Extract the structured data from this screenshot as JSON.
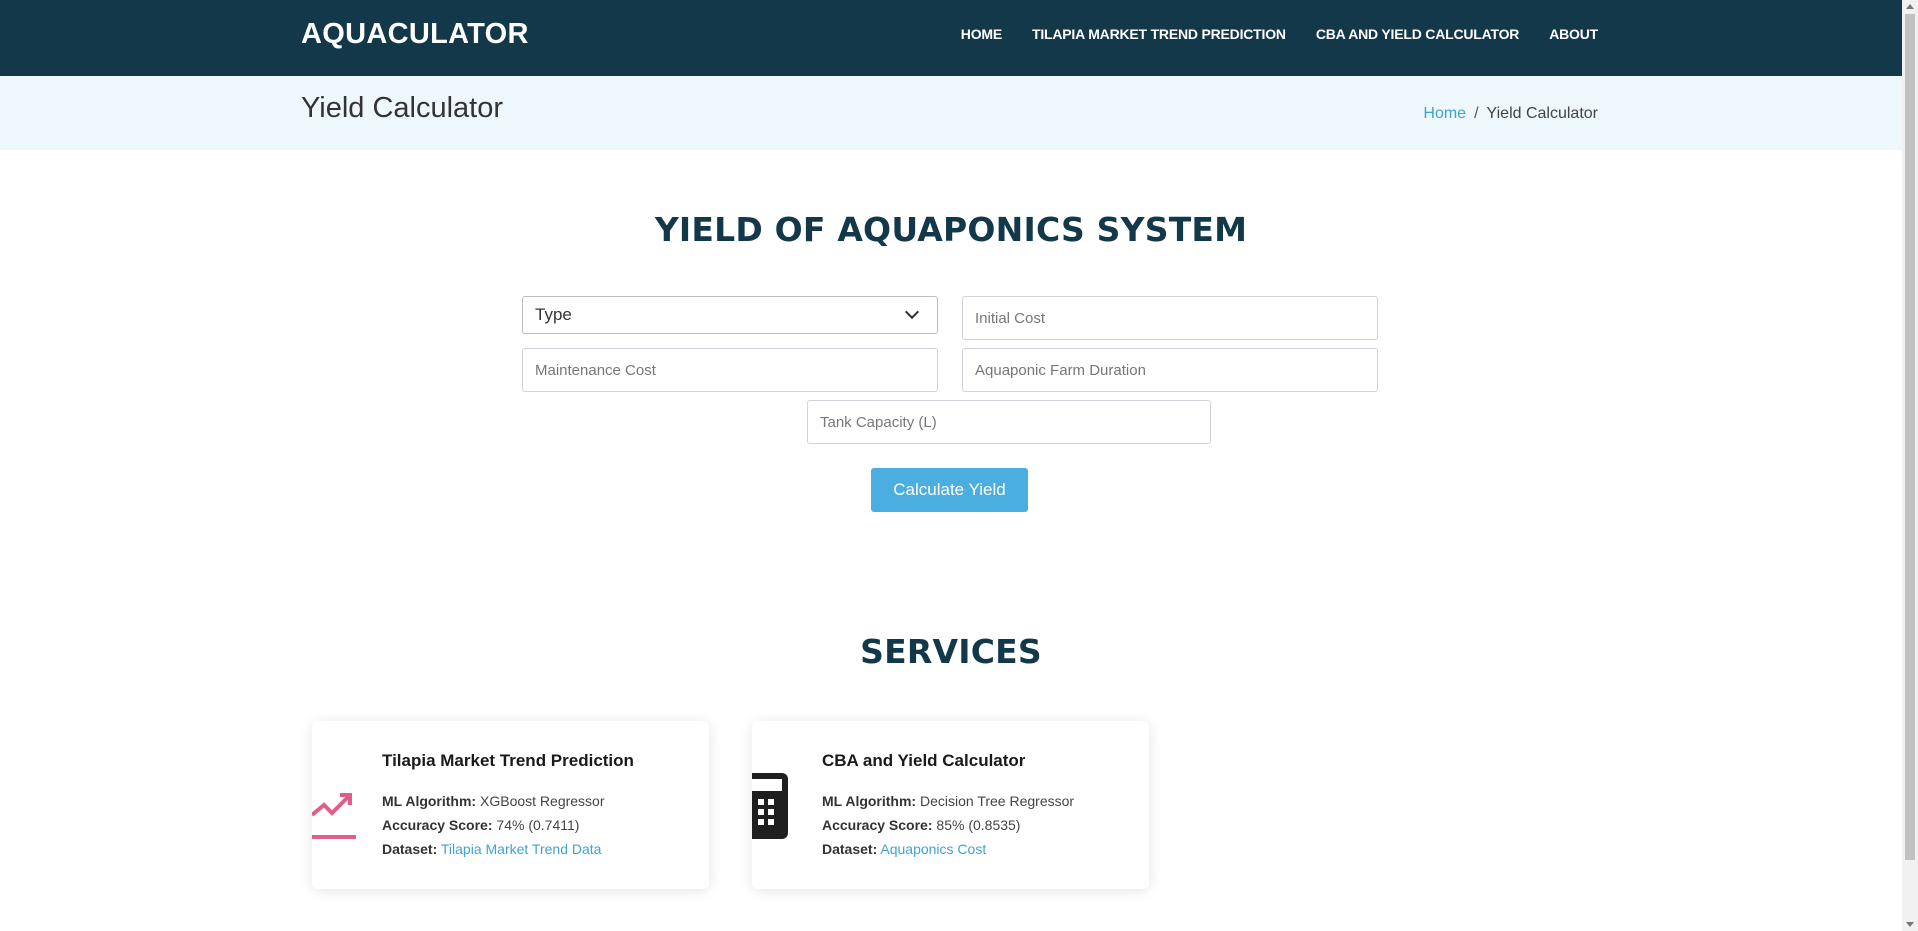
{
  "header": {
    "logo": "AQUACULATOR",
    "nav": [
      "HOME",
      "TILAPIA MARKET TREND PREDICTION",
      "CBA AND YIELD CALCULATOR",
      "ABOUT"
    ]
  },
  "breadcrumb": {
    "page_title": "Yield Calculator",
    "home": "Home",
    "separator": "/",
    "current": "Yield Calculator"
  },
  "form": {
    "title": "YIELD OF AQUAPONICS SYSTEM",
    "type_select": "Type",
    "initial_cost_placeholder": "Initial Cost",
    "maintenance_cost_placeholder": "Maintenance Cost",
    "duration_placeholder": "Aquaponic Farm Duration",
    "tank_capacity_placeholder": "Tank Capacity (L)",
    "button": "Calculate Yield"
  },
  "services": {
    "title": "SERVICES",
    "cards": [
      {
        "title": "Tilapia Market Trend Prediction",
        "algo_label": "ML Algorithm:",
        "algo": "XGBoost Regressor",
        "accuracy_label": "Accuracy Score:",
        "accuracy": "74% (0.7411)",
        "dataset_label": "Dataset:",
        "dataset": "Tilapia Market Trend Data",
        "icon": "trend-up-icon",
        "icon_color": "#e35d8c"
      },
      {
        "title": "CBA and Yield Calculator",
        "algo_label": "ML Algorithm:",
        "algo": "Decision Tree Regressor",
        "accuracy_label": "Accuracy Score:",
        "accuracy": "85% (0.8535)",
        "dataset_label": "Dataset:",
        "dataset": "Aquaponics Cost",
        "icon": "calculator-icon",
        "icon_color": "#1f1f1f"
      }
    ]
  },
  "colors": {
    "header_bg": "#13384a",
    "band_bg": "#eef8fc",
    "accent": "#4aaee0",
    "link": "#3fa3cf"
  }
}
